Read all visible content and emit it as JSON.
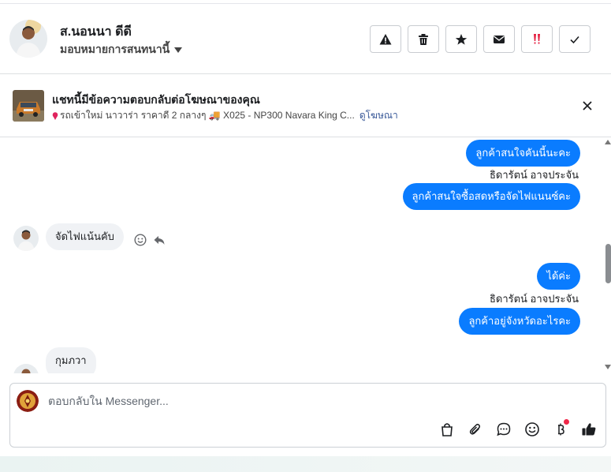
{
  "header": {
    "contact_name": "ส.นอนนา ดีดี",
    "assign_label": "มอบหมายการสนทนานี้",
    "actions": [
      {
        "name": "report-spam-button",
        "icon": "warning-icon"
      },
      {
        "name": "delete-button",
        "icon": "trash-icon"
      },
      {
        "name": "star-button",
        "icon": "star-icon"
      },
      {
        "name": "mark-unread-button",
        "icon": "envelope-icon"
      },
      {
        "name": "follow-up-button",
        "icon": "double-exclamation-icon"
      },
      {
        "name": "mark-done-button",
        "icon": "checkmark-icon"
      }
    ]
  },
  "ad": {
    "title": "แชทนี้มีข้อความตอบกลับต่อโฆษณาของคุณ",
    "description": "รถเข้าใหม่ นาวาร่า ราคาดี 2 กลางๆ 🚚 X025 - NP300 Navara King C...",
    "link_label": "ดูโฆษณา"
  },
  "messages": {
    "out_1": "ลูกค้าสนใจคันนี้นะคะ",
    "sender_1": "ธิดารัตน์ อาจประจัน",
    "out_2": "ลูกค้าสนใจซื้อสดหรือจัดไฟแนนซ์คะ",
    "in_1": "จัดไฟแน้นคับ",
    "out_3": "ได้ค่ะ",
    "sender_2": "ธิดารัตน์ อาจประจัน",
    "out_4": "ลูกค้าอยู่จังหวัดอะไรคะ",
    "in_2": "กุมภวา"
  },
  "composer": {
    "placeholder": "ตอบกลับใน Messenger..."
  },
  "colors": {
    "outgoing_bubble": "#0a7cff",
    "incoming_bubble": "#f0f2f5",
    "link": "#385898",
    "badge": "#f02849"
  }
}
